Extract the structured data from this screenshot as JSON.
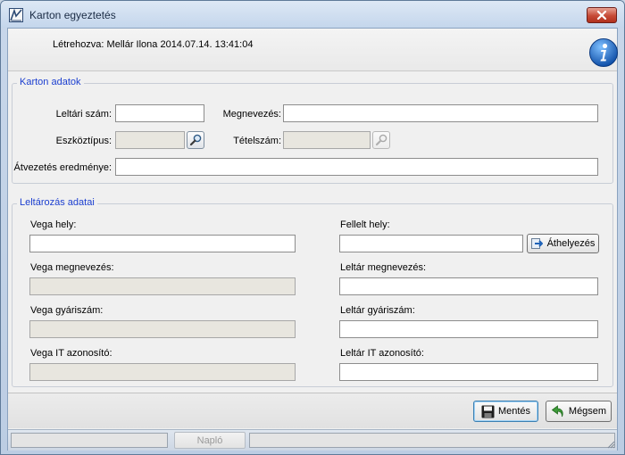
{
  "window": {
    "title": "Karton egyeztetés"
  },
  "header": {
    "created_text": "Létrehozva: Mellár Ilona 2014.07.14. 13:41:04"
  },
  "karton": {
    "group_title": "Karton adatok",
    "leltari_szam_label": "Leltári szám:",
    "leltari_szam_value": "",
    "megnevezes_label": "Megnevezés:",
    "megnevezes_value": "",
    "eszkoztipus_label": "Eszköztípus:",
    "eszkoztipus_value": "",
    "tetelszam_label": "Tételszám:",
    "tetelszam_value": "",
    "atvezetes_label": "Átvezetés eredménye:",
    "atvezetes_value": ""
  },
  "leltar": {
    "group_title": "Leltározás adatai",
    "vega_hely_label": "Vega hely:",
    "vega_hely_value": "",
    "vega_megnevezes_label": "Vega megnevezés:",
    "vega_megnevezes_value": "",
    "vega_gyariszam_label": "Vega gyáriszám:",
    "vega_gyariszam_value": "",
    "vega_it_label": "Vega IT azonosító:",
    "vega_it_value": "",
    "fellelt_hely_label": "Fellelt hely:",
    "fellelt_hely_value": "",
    "athelyezes_label": "Áthelyezés",
    "leltar_megnevezes_label": "Leltár megnevezés:",
    "leltar_megnevezes_value": "",
    "leltar_gyariszam_label": "Leltár gyáriszám:",
    "leltar_gyariszam_value": "",
    "leltar_it_label": "Leltár IT azonosító:",
    "leltar_it_value": ""
  },
  "footer": {
    "save_label": "Mentés",
    "cancel_label": "Mégsem"
  },
  "statusbar": {
    "naplo_label": "Napló"
  },
  "icons": {
    "app": "app-logo-icon",
    "close": "close-icon",
    "info": "info-icon",
    "lookup": "magnifier-icon",
    "move": "move-arrow-icon",
    "save": "floppy-disk-icon",
    "cancel": "undo-arrow-icon"
  },
  "colors": {
    "group_title": "#1c3fd0",
    "close_button": "#c64a36",
    "info_icon": "#1f6fc9"
  }
}
